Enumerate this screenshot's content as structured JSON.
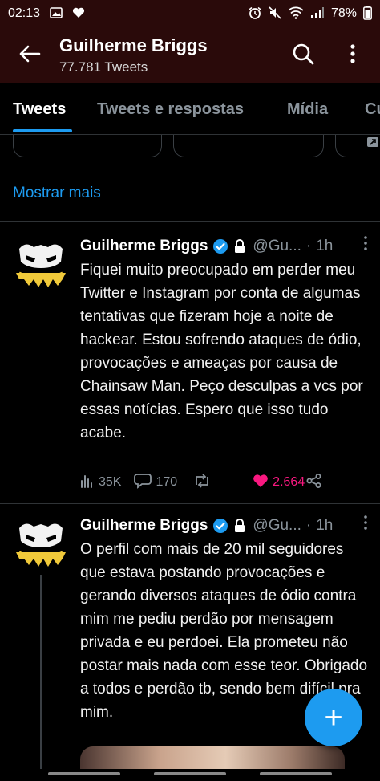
{
  "status_bar": {
    "time": "02:13",
    "battery": "78%",
    "left_icons": [
      "image-icon",
      "heart-icon"
    ],
    "right_icons": [
      "alarm-icon",
      "mute-icon",
      "wifi-icon",
      "signal-icon"
    ]
  },
  "header": {
    "title": "Guilherme Briggs",
    "subtitle": "77.781 Tweets"
  },
  "tabs": [
    "Tweets",
    "Tweets e respostas",
    "Mídia",
    "Cu"
  ],
  "show_more": "Mostrar mais",
  "tweets": [
    {
      "name": "Guilherme Briggs",
      "handle": "@Gu...",
      "separator": "·",
      "time": "1h",
      "text": "Fiquei muito preocupado em perder meu Twitter e Instagram por conta de algumas tentativas que fizeram hoje a noite de hackear. Estou sofrendo ataques de ódio, provocações e ameaças por causa de Chainsaw Man. Peço desculpas a vcs por essas notícias. Espero que isso tudo acabe.",
      "views": "35K",
      "replies": "170",
      "likes": "2.664"
    },
    {
      "name": "Guilherme Briggs",
      "handle": "@Gu...",
      "separator": "·",
      "time": "1h",
      "text": "O perfil com mais de 20 mil seguidores que estava postando provocações e gerando diversos ataques de ódio contra mim me pediu perdão por mensagem privada e eu perdoei. Ela prometeu não postar mais nada com esse teor. Obrigado a todos e perdão tb, sendo bem difícil pra mim."
    }
  ],
  "colors": {
    "accent": "#1d9bf0",
    "like": "#f91880",
    "header_bg": "#2a0a0a"
  },
  "fab_label": "+"
}
